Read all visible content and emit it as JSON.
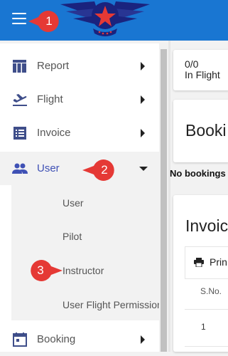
{
  "topbar": {
    "color": "#1976d2",
    "menu_icon": "hamburger-icon",
    "logo": "winged-star-logo"
  },
  "annotations": [
    {
      "number": "1",
      "target": "menu-button"
    },
    {
      "number": "2",
      "target": "nav-user"
    },
    {
      "number": "3",
      "target": "submenu-instructor"
    }
  ],
  "sidebar": {
    "items": [
      {
        "label": "Report",
        "icon": "table-icon"
      },
      {
        "label": "Flight",
        "icon": "flight-takeoff-icon"
      },
      {
        "label": "Invoice",
        "icon": "list-icon"
      },
      {
        "label": "User",
        "icon": "people-icon",
        "expanded": true
      },
      {
        "label": "Booking",
        "icon": "calendar-icon"
      }
    ],
    "user_submenu": [
      "User",
      "Pilot",
      "Instructor",
      "User Flight Permission"
    ]
  },
  "main": {
    "flight_card": {
      "count": "0/0",
      "label": "In Flight"
    },
    "bookings_title": "Booki",
    "no_bookings": "No bookings",
    "invoices_title": "Invoic",
    "print_label": "Prin",
    "table_header_sno": "S.No.",
    "table_row_1": "1"
  },
  "colors": {
    "accent": "#3f51b5",
    "callout": "#e53935",
    "primary": "#1976d2"
  }
}
